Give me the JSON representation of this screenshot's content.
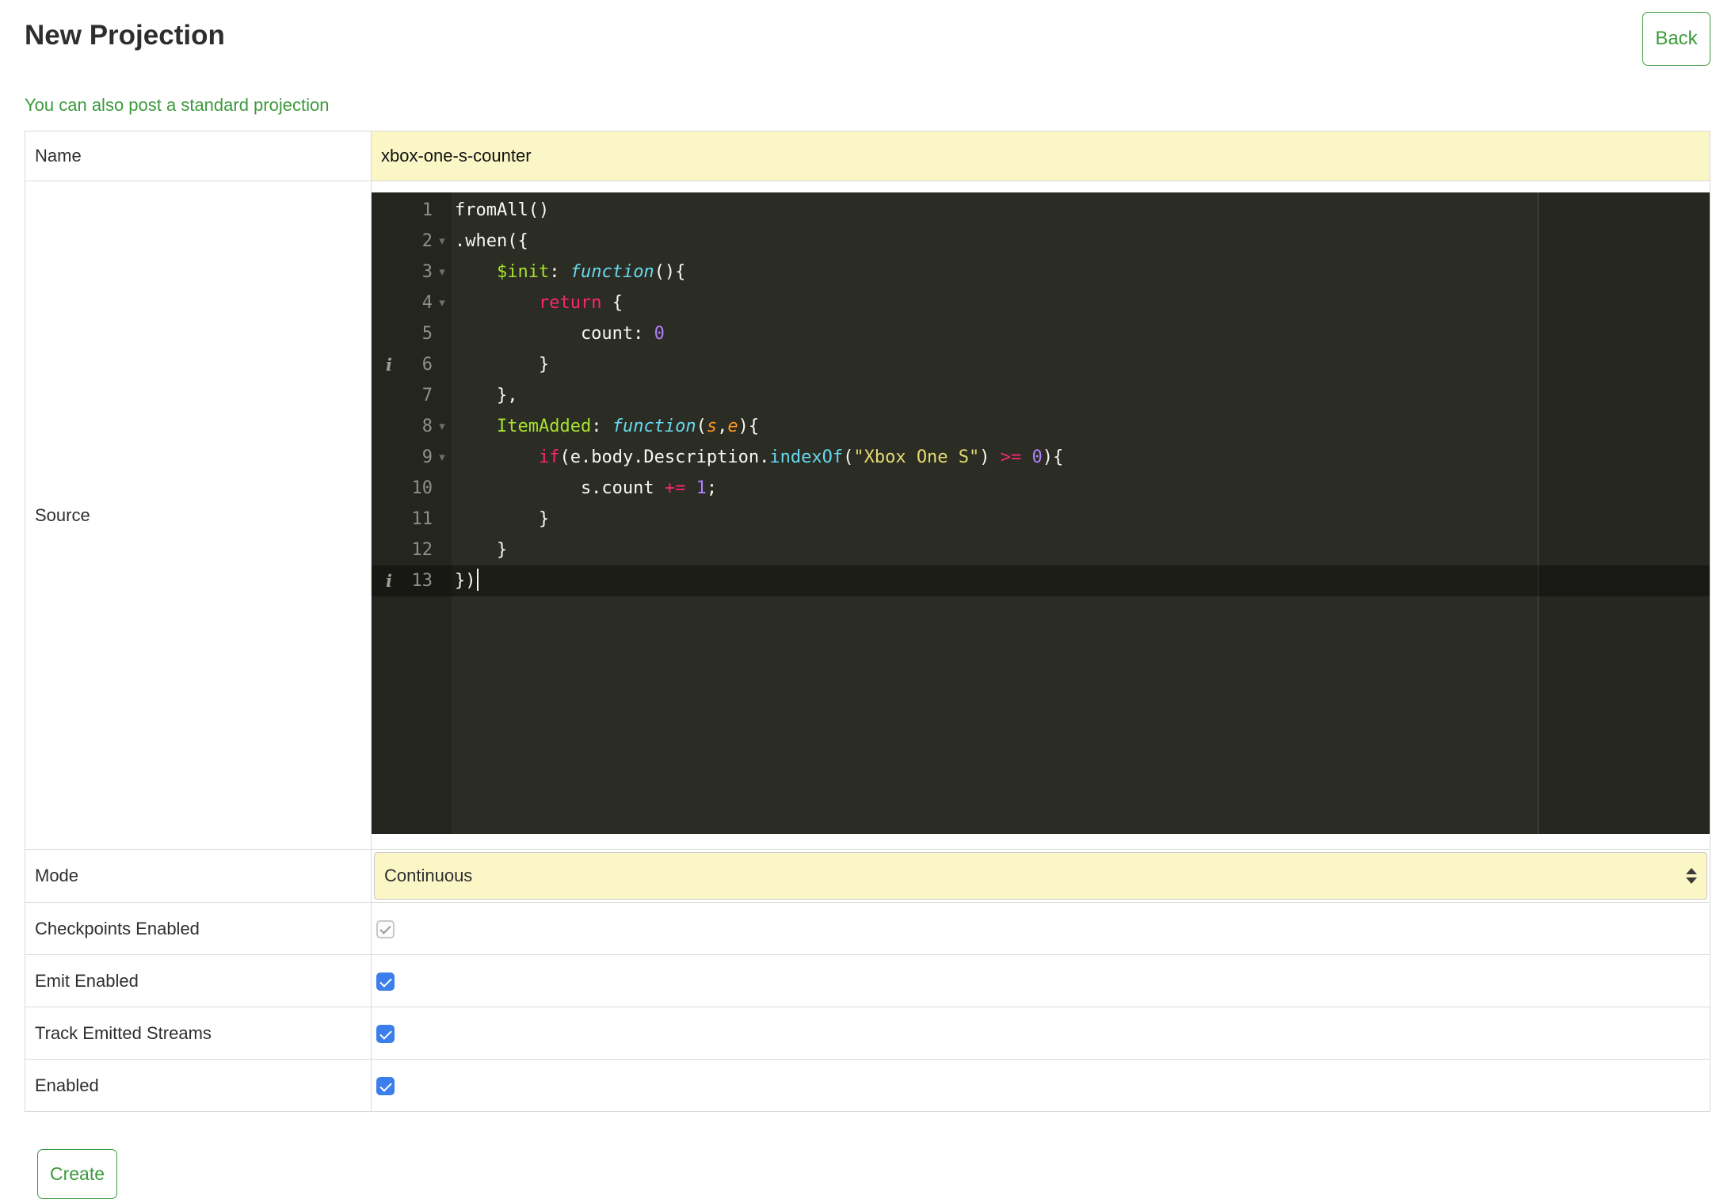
{
  "colors": {
    "accent_green": "#3c9a3c",
    "field_yellow": "#faf6c6",
    "editor_background": "#2b2c24",
    "editor_gutter": "#24251e",
    "checkbox_blue": "#3c7eec"
  },
  "page": {
    "title": "New Projection",
    "back_label": "Back",
    "hint_link": "You can also post a standard projection",
    "create_label": "Create"
  },
  "form": {
    "name": {
      "label": "Name",
      "value": "xbox-one-s-counter"
    },
    "source_label": "Source",
    "mode": {
      "label": "Mode",
      "value": "Continuous"
    },
    "checkboxes": [
      {
        "label": "Checkpoints Enabled",
        "checked": true,
        "disabled": true
      },
      {
        "label": "Emit Enabled",
        "checked": true,
        "disabled": false
      },
      {
        "label": "Track Emitted Streams",
        "checked": true,
        "disabled": false
      },
      {
        "label": "Enabled",
        "checked": true,
        "disabled": false
      }
    ]
  },
  "editor": {
    "icons": {
      "info": "i",
      "fold": "▾"
    },
    "lines": [
      {
        "n": "1",
        "tokens": [
          [
            "fromAll()",
            "plain"
          ]
        ]
      },
      {
        "n": "2",
        "fold": true,
        "tokens": [
          [
            ".when({",
            "plain"
          ]
        ]
      },
      {
        "n": "3",
        "fold": true,
        "tokens": [
          [
            "    ",
            "plain"
          ],
          [
            "$init",
            "decl"
          ],
          [
            ": ",
            "plain"
          ],
          [
            "function",
            "fn"
          ],
          [
            "(){",
            "plain"
          ]
        ]
      },
      {
        "n": "4",
        "fold": true,
        "tokens": [
          [
            "        ",
            "plain"
          ],
          [
            "return",
            "kw"
          ],
          [
            " {",
            "plain"
          ]
        ]
      },
      {
        "n": "5",
        "tokens": [
          [
            "            count: ",
            "plain"
          ],
          [
            "0",
            "num"
          ]
        ]
      },
      {
        "n": "6",
        "info": true,
        "tokens": [
          [
            "        }",
            "plain"
          ]
        ]
      },
      {
        "n": "7",
        "tokens": [
          [
            "    },",
            "plain"
          ]
        ]
      },
      {
        "n": "8",
        "fold": true,
        "tokens": [
          [
            "    ",
            "plain"
          ],
          [
            "ItemAdded",
            "decl"
          ],
          [
            ": ",
            "plain"
          ],
          [
            "function",
            "fn"
          ],
          [
            "(",
            "plain"
          ],
          [
            "s",
            "param"
          ],
          [
            ",",
            "plain"
          ],
          [
            "e",
            "param"
          ],
          [
            "){",
            "plain"
          ]
        ]
      },
      {
        "n": "9",
        "fold": true,
        "tokens": [
          [
            "        ",
            "plain"
          ],
          [
            "if",
            "kw"
          ],
          [
            "(e.body.Description.",
            "plain"
          ],
          [
            "indexOf",
            "sup"
          ],
          [
            "(",
            "plain"
          ],
          [
            "\"Xbox One S\"",
            "str"
          ],
          [
            ") ",
            "plain"
          ],
          [
            ">=",
            "kw"
          ],
          [
            " ",
            "plain"
          ],
          [
            "0",
            "num"
          ],
          [
            "){",
            "plain"
          ]
        ]
      },
      {
        "n": "10",
        "tokens": [
          [
            "            s.count ",
            "plain"
          ],
          [
            "+=",
            "kw"
          ],
          [
            " ",
            "plain"
          ],
          [
            "1",
            "num"
          ],
          [
            ";",
            "plain"
          ]
        ]
      },
      {
        "n": "11",
        "tokens": [
          [
            "        }",
            "plain"
          ]
        ]
      },
      {
        "n": "12",
        "tokens": [
          [
            "    }",
            "plain"
          ]
        ]
      },
      {
        "n": "13",
        "info": true,
        "active": true,
        "cursor": true,
        "tokens": [
          [
            "})",
            "plain"
          ]
        ]
      }
    ]
  }
}
